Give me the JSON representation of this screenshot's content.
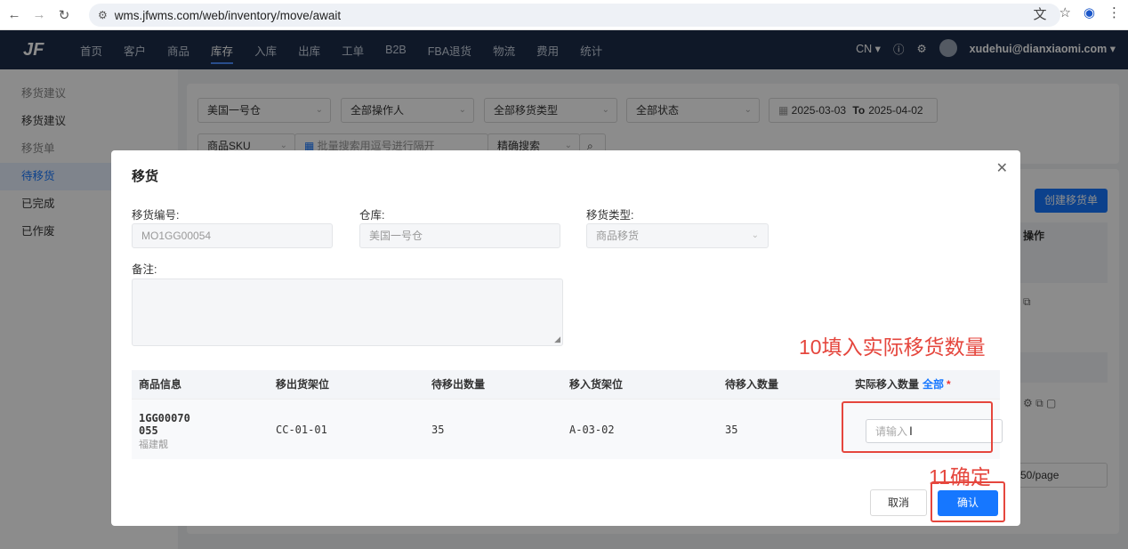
{
  "browser": {
    "url": "wms.jfwms.com/web/inventory/move/await"
  },
  "header": {
    "logo": "JF",
    "nav": [
      "首页",
      "客户",
      "商品",
      "库存",
      "入库",
      "出库",
      "工单",
      "B2B",
      "FBA退货",
      "物流",
      "费用",
      "统计"
    ],
    "active_nav": "库存",
    "lang": "CN ▾",
    "user": "xudehui@dianxiaomi.com ▾"
  },
  "sidebar": {
    "items": [
      {
        "label": "移货建议",
        "kind": "group"
      },
      {
        "label": "移货建议",
        "kind": "item"
      },
      {
        "label": "移货单",
        "kind": "group"
      },
      {
        "label": "待移货",
        "kind": "active"
      },
      {
        "label": "已完成",
        "kind": "item"
      },
      {
        "label": "已作废",
        "kind": "item"
      }
    ]
  },
  "filters": {
    "warehouse": "美国一号仓",
    "operator": "全部操作人",
    "move_type": "全部移货类型",
    "status": "全部状态",
    "date_from": "2025-03-03",
    "date_to_label": "To",
    "date_to": "2025-04-02",
    "search_field": "商品SKU",
    "batch_search": "批量搜索用逗号进行隔开",
    "search_mode": "精确搜索"
  },
  "list": {
    "create_button": "创建移货单",
    "op_header": "操作",
    "page_size": "50/page"
  },
  "modal": {
    "title": "移货",
    "move_no_label": "移货编号:",
    "move_no": "MO1GG00054",
    "warehouse_label": "仓库:",
    "warehouse": "美国一号仓",
    "type_label": "移货类型:",
    "type": "商品移货",
    "remark_label": "备注:",
    "table": {
      "headers": [
        "商品信息",
        "移出货架位",
        "待移出数量",
        "移入货架位",
        "待移入数量",
        "实际移入数量"
      ],
      "all_link": "全部",
      "required_mark": "*",
      "row": {
        "sku_line1": "1GG00070",
        "sku_line2": "055",
        "sku_sub": "福建靓",
        "from_shelf": "CC-01-01",
        "out_qty": "35",
        "to_shelf": "A-03-02",
        "in_qty": "35",
        "actual_placeholder": "请输入"
      }
    },
    "cancel_button": "取消",
    "ok_button": "确认"
  },
  "annotations": {
    "step10": "10填入实际移货数量",
    "step11": "11确定",
    "color": "#e5463d"
  }
}
